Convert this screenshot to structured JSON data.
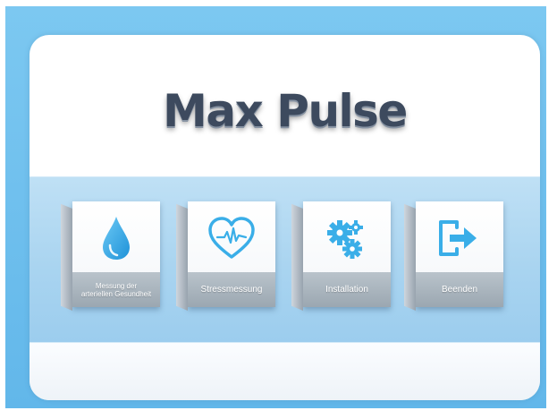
{
  "app": {
    "title": "Max Pulse"
  },
  "menu": {
    "items": [
      {
        "label": "Messung der\narteriellen Gesundheit",
        "icon": "water-drop-icon"
      },
      {
        "label": "Stressmessung",
        "icon": "heart-pulse-icon"
      },
      {
        "label": "Installation",
        "icon": "gears-icon"
      },
      {
        "label": "Beenden",
        "icon": "exit-icon"
      }
    ]
  },
  "colors": {
    "background": "#6fc0ee",
    "icon_blue": "#3aaee8",
    "title": "#3d4a5e",
    "label_bar": "#a9b4bd"
  }
}
